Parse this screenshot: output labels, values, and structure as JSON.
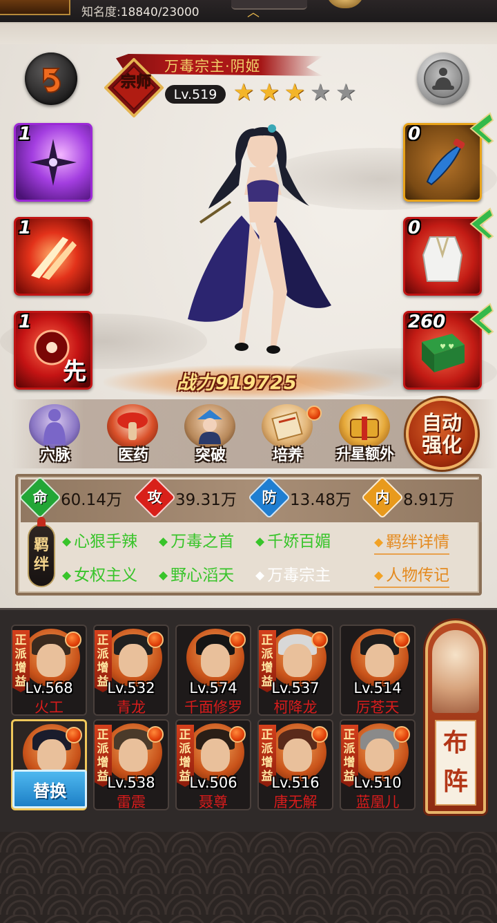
{
  "topbar": {
    "fame_label": "知名度:",
    "fame_value": "18840/23000"
  },
  "hero": {
    "name": "万毒宗主·阴姬",
    "rank_badge": "宗师",
    "level": "Lv.519",
    "stars_total": 5,
    "stars_filled": 3,
    "combat_power": "战力919725"
  },
  "skills": [
    {
      "count": "1",
      "icon": "shuriken-skill-icon"
    },
    {
      "count": "1",
      "icon": "slash-skill-icon"
    },
    {
      "count": "1",
      "icon": "first-strike-skill-icon",
      "tag": "先"
    }
  ],
  "equipment": [
    {
      "count": "0",
      "icon": "dagger-icon"
    },
    {
      "count": "0",
      "icon": "white-robe-icon"
    },
    {
      "count": "260",
      "icon": "green-book-icon"
    }
  ],
  "functions": [
    {
      "label": "穴脉",
      "icon": "meridian-icon",
      "badge": false
    },
    {
      "label": "医药",
      "icon": "medicine-icon",
      "badge": false
    },
    {
      "label": "突破",
      "icon": "breakthrough-icon",
      "badge": false
    },
    {
      "label": "培养",
      "icon": "cultivate-scroll-icon",
      "badge": true
    },
    {
      "label": "升星额外",
      "icon": "star-upgrade-icon",
      "badge": false
    }
  ],
  "auto_enhance": {
    "line1": "自动",
    "line2": "强化"
  },
  "stats": [
    {
      "icon": "命",
      "value": "60.14万",
      "color": "#23a636"
    },
    {
      "icon": "攻",
      "value": "39.31万",
      "color": "#d8201a"
    },
    {
      "icon": "防",
      "value": "13.48万",
      "color": "#1f7ed1"
    },
    {
      "icon": "内",
      "value": "8.91万",
      "color": "#e89a1c"
    }
  ],
  "bonds": {
    "label_top": "羁",
    "label_bottom": "绊",
    "traits": [
      {
        "text": "心狠手辣",
        "active": true
      },
      {
        "text": "万毒之首",
        "active": true
      },
      {
        "text": "千娇百媚",
        "active": true
      },
      {
        "text": "女权主义",
        "active": true
      },
      {
        "text": "野心滔天",
        "active": true
      },
      {
        "text": "万毒宗主",
        "active": false
      }
    ],
    "bond_details": "羁绊详情",
    "biography": "人物传记"
  },
  "lineup": {
    "ribbon_text": "正派增益",
    "heroes": [
      {
        "level": "Lv.568",
        "name": "火工",
        "ribbon": true
      },
      {
        "level": "Lv.532",
        "name": "青龙",
        "ribbon": true
      },
      {
        "level": "Lv.574",
        "name": "千面修罗",
        "ribbon": false
      },
      {
        "level": "Lv.537",
        "name": "柯降龙",
        "ribbon": true
      },
      {
        "level": "Lv.514",
        "name": "厉苍天",
        "ribbon": false
      },
      {
        "level": "",
        "name": "",
        "ribbon": false,
        "selected": true
      },
      {
        "level": "Lv.538",
        "name": "雷震",
        "ribbon": true
      },
      {
        "level": "Lv.506",
        "name": "聂尊",
        "ribbon": true
      },
      {
        "level": "Lv.516",
        "name": "唐无解",
        "ribbon": true
      },
      {
        "level": "Lv.510",
        "name": "蓝凰儿",
        "ribbon": true
      }
    ],
    "swap_label": "替换",
    "formation_line1": "布",
    "formation_line2": "阵"
  },
  "colors": {
    "accent_red": "#c11414",
    "gold": "#f3b529",
    "trait_green": "#38c42a",
    "link_orange": "#e48a1f"
  }
}
